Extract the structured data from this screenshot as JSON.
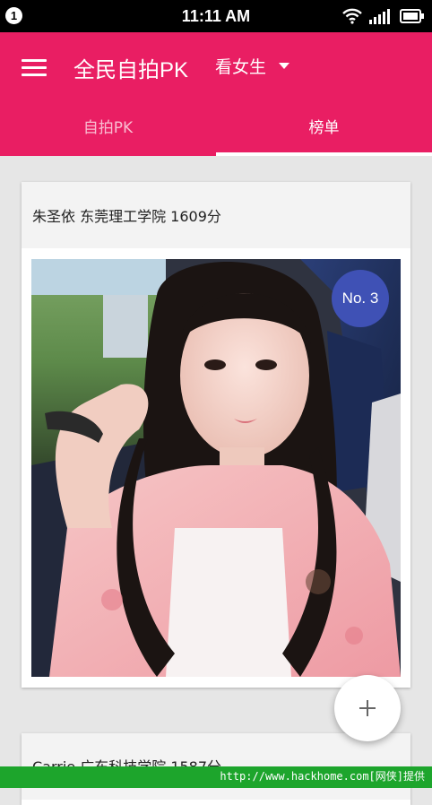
{
  "status_bar": {
    "notification_count": "1",
    "time": "11:11 AM"
  },
  "app_bar": {
    "title": "全民自拍PK",
    "filter_label": "看女生"
  },
  "tabs": [
    {
      "label": "自拍PK",
      "active": false
    },
    {
      "label": "榜单",
      "active": true
    }
  ],
  "cards": [
    {
      "header": "朱圣依 东莞理工学院 1609分",
      "rank": "No. 3"
    },
    {
      "header": "Carrie 广东科技学院 1587分"
    }
  ],
  "watermark": "http://www.hackhome.com[网侠]提供",
  "colors": {
    "primary": "#e91e63",
    "rank_badge": "#3f51b5",
    "strip": "#1da52c"
  }
}
